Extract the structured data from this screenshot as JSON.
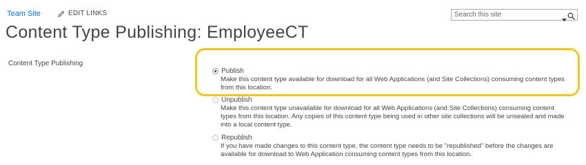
{
  "topbar": {
    "site_link": "Team Site",
    "edit_links": "EDIT LINKS",
    "search_placeholder": "Search this site"
  },
  "page": {
    "title": "Content Type Publishing: EmployeeCT"
  },
  "section": {
    "label": "Content Type Publishing"
  },
  "options": [
    {
      "label": "Publish",
      "selected": true,
      "desc_lines": [
        "Make this content type available for download for all Web Applications (and Site Collections) consuming content types",
        "from this location."
      ]
    },
    {
      "label": "Unpublish",
      "selected": false,
      "desc_lines": [
        "Make this content type unavailable for download for all Web Applications (and Site Collections) consuming content",
        "types from this location. Any copies of this content type being used in other site collections will be unsealed and made",
        "into a local content type."
      ]
    },
    {
      "label": "Republish",
      "selected": false,
      "desc_lines": [
        "If you have made changes to this content type, the content type needs to be \"republished\" before the changes are",
        "available for download to Web Application consuming content types from this location."
      ]
    }
  ],
  "colors": {
    "link": "#0072c6",
    "highlight": "#f2c41f",
    "text": "#444444"
  }
}
